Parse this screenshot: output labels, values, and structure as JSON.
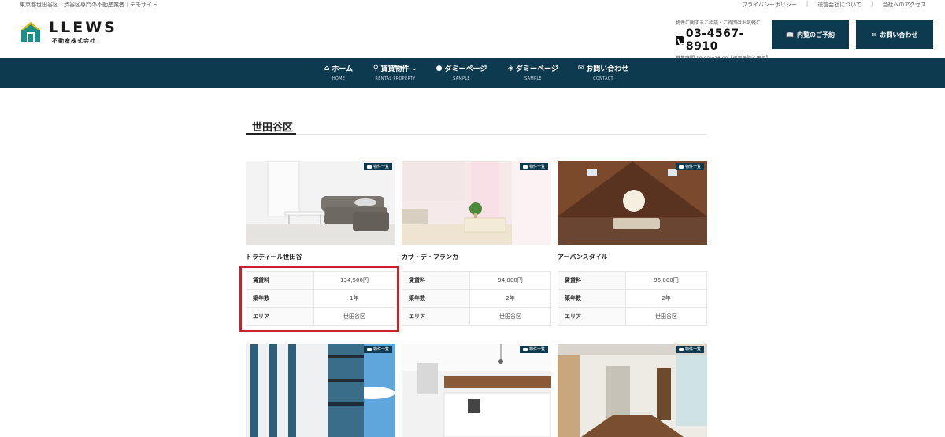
{
  "topbar": {
    "tagline": "東京都世田谷区・渋谷区専門の不動産業者｜デモサイト",
    "links": [
      "プライバシーポリシー",
      "運営会社について",
      "当社へのアクセス"
    ]
  },
  "logo": {
    "name": "LLEWS",
    "company": "不動産株式会社"
  },
  "contact": {
    "note": "物件に関するご相談・ご質問はお気軽に",
    "phone": "03-4567-8910",
    "hours": "営業時間 10:00〜18:00【祝日を除く平日】"
  },
  "header_buttons": {
    "reserve": "内覧のご予約",
    "contact": "お問い合わせ"
  },
  "nav": [
    {
      "label": "ホーム",
      "sub": "HOME",
      "icon": "home-icon"
    },
    {
      "label": "賃貸物件",
      "sub": "RENTAL PROPERTY",
      "icon": "search-icon",
      "dropdown": true
    },
    {
      "label": "ダミーページ",
      "sub": "SAMPLE",
      "icon": "users-icon"
    },
    {
      "label": "ダミーページ",
      "sub": "SAMPLE",
      "icon": "layers-icon"
    },
    {
      "label": "お問い合わせ",
      "sub": "CONTACT",
      "icon": "mail-icon"
    }
  ],
  "section": {
    "title": "世田谷区"
  },
  "badge_label": "物件一覧",
  "labels": {
    "rent": "賃貸料",
    "age": "築年数",
    "area": "エリア"
  },
  "properties": [
    {
      "name": "トラディール世田谷",
      "rent": "134,500円",
      "age": "1年",
      "area": "世田谷区"
    },
    {
      "name": "カサ・デ・ブランカ",
      "rent": "94,000円",
      "age": "2年",
      "area": "世田谷区"
    },
    {
      "name": "アーバンスタイル",
      "rent": "95,000円",
      "age": "2年",
      "area": "世田谷区"
    }
  ],
  "colors": {
    "brand": "#0d3a4f",
    "highlight": "#c9202a"
  }
}
